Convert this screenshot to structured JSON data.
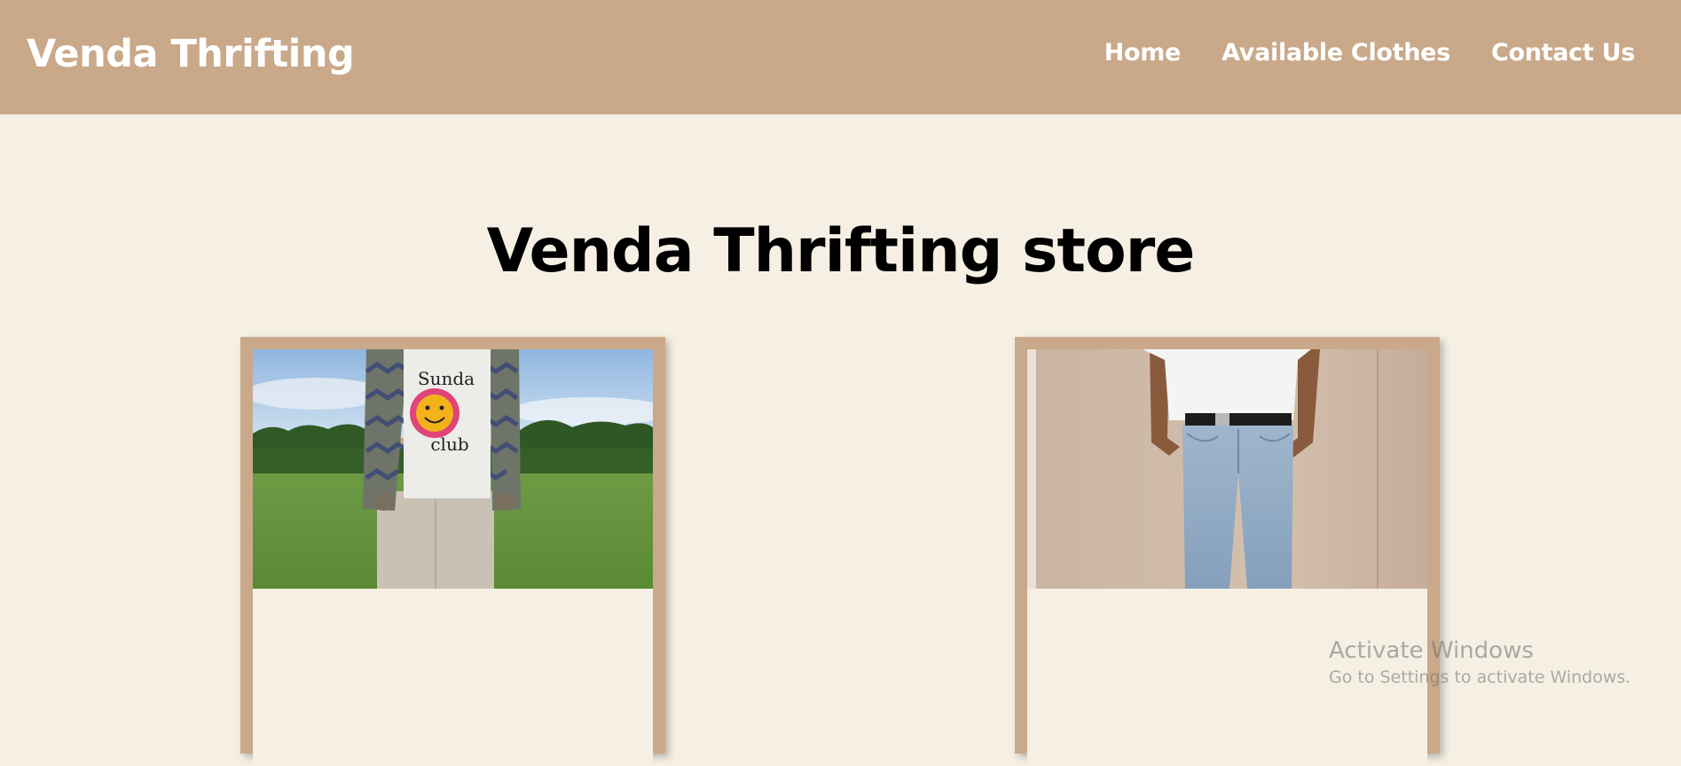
{
  "navbar": {
    "brand": "Venda Thrifting",
    "links": [
      {
        "label": "Home"
      },
      {
        "label": "Available Clothes"
      },
      {
        "label": "Contact Us"
      }
    ]
  },
  "main": {
    "title": "Venda Thrifting store",
    "cards": [
      {
        "image_label": "person wearing knit cardigan, graphic tee and beige trousers in a field",
        "shirt_text_top": "Sunda",
        "shirt_text_bottom": "club"
      },
      {
        "image_label": "person wearing white t-shirt, black belt and light-wash jeans"
      }
    ]
  },
  "os_overlay": {
    "title": "Activate Windows",
    "subtitle": "Go to Settings to activate Windows."
  },
  "colors": {
    "navbar_bg": "#c9a98a",
    "page_bg": "#f6f0e4",
    "card_frame": "#c9a98a"
  }
}
